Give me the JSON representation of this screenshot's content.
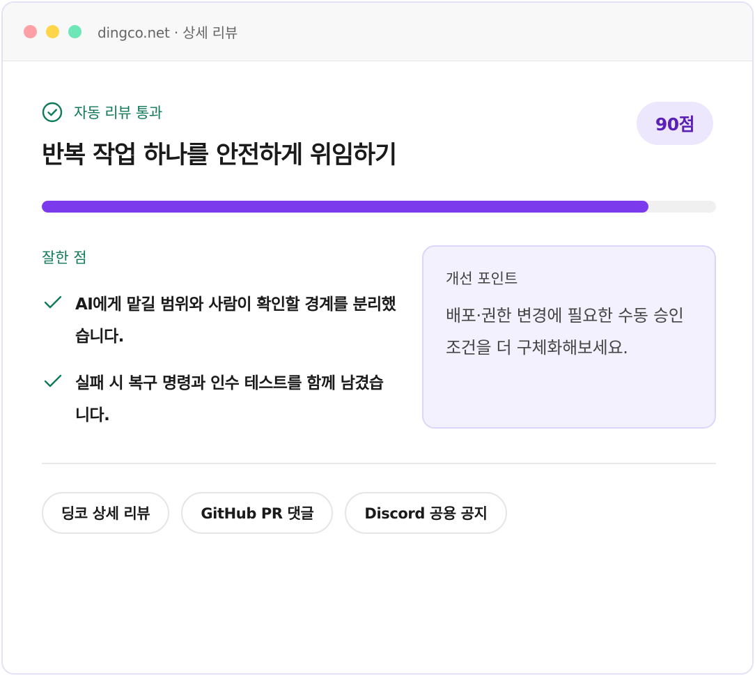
{
  "window": {
    "title": "dingco.net · 상세 리뷰",
    "dot_colors": [
      "#ff9fa6",
      "#ffd54a",
      "#6ee7b7"
    ]
  },
  "review": {
    "status": "자동 리뷰 통과",
    "status_icon": "check-circle-icon",
    "score": "90점",
    "title": "반복 작업 하나를 안전하게 위임하기",
    "progress_fraction": 0.9,
    "accent_color": "#7c3aed",
    "good_label": "잘한 점",
    "good_points": [
      "AI에게 맡길 범위와 사람이 확인할 경계를 분리했습니다.",
      "실패 시 복구 명령과 인수 테스트를 함께 남겼습니다."
    ],
    "improve_label": "개선 포인트",
    "improve_text": "배포·권한 변경에 필요한 수동 승인 조건을 더 구체화해보세요."
  },
  "channels": [
    "딩코 상세 리뷰",
    "GitHub PR 댓글",
    "Discord 공용 공지"
  ]
}
